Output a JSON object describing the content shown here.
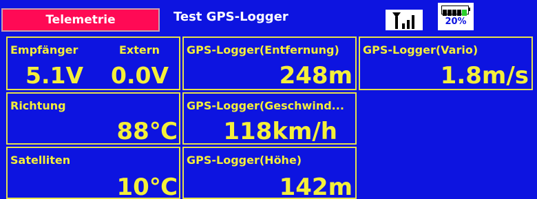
{
  "header": {
    "tab_label": "Telemetrie",
    "title": "Test GPS-Logger",
    "signal_icon": "signal-strength-icon",
    "battery": {
      "percent_label": "20%",
      "level": 0.2
    }
  },
  "tiles": {
    "empfaenger": {
      "label": "Empfänger",
      "value": "5.1V"
    },
    "extern": {
      "label": "Extern",
      "value": "0.0V"
    },
    "entfernung": {
      "label": "GPS-Logger(Entfernung)",
      "value": "248m"
    },
    "vario": {
      "label": "GPS-Logger(Vario)",
      "value": "1.8m/s"
    },
    "richtung": {
      "label": "Richtung",
      "value": "88℃"
    },
    "geschwindigkeit": {
      "label": "GPS-Logger(Geschwind...",
      "value": "118km/h"
    },
    "satelliten": {
      "label": "Satelliten",
      "value": "10℃"
    },
    "hoehe": {
      "label": "GPS-Logger(Höhe)",
      "value": "142m"
    }
  },
  "colors": {
    "background": "#0d14e0",
    "tab": "#ff0a55",
    "text": "#f4ef3a",
    "border": "#e6e24a"
  }
}
